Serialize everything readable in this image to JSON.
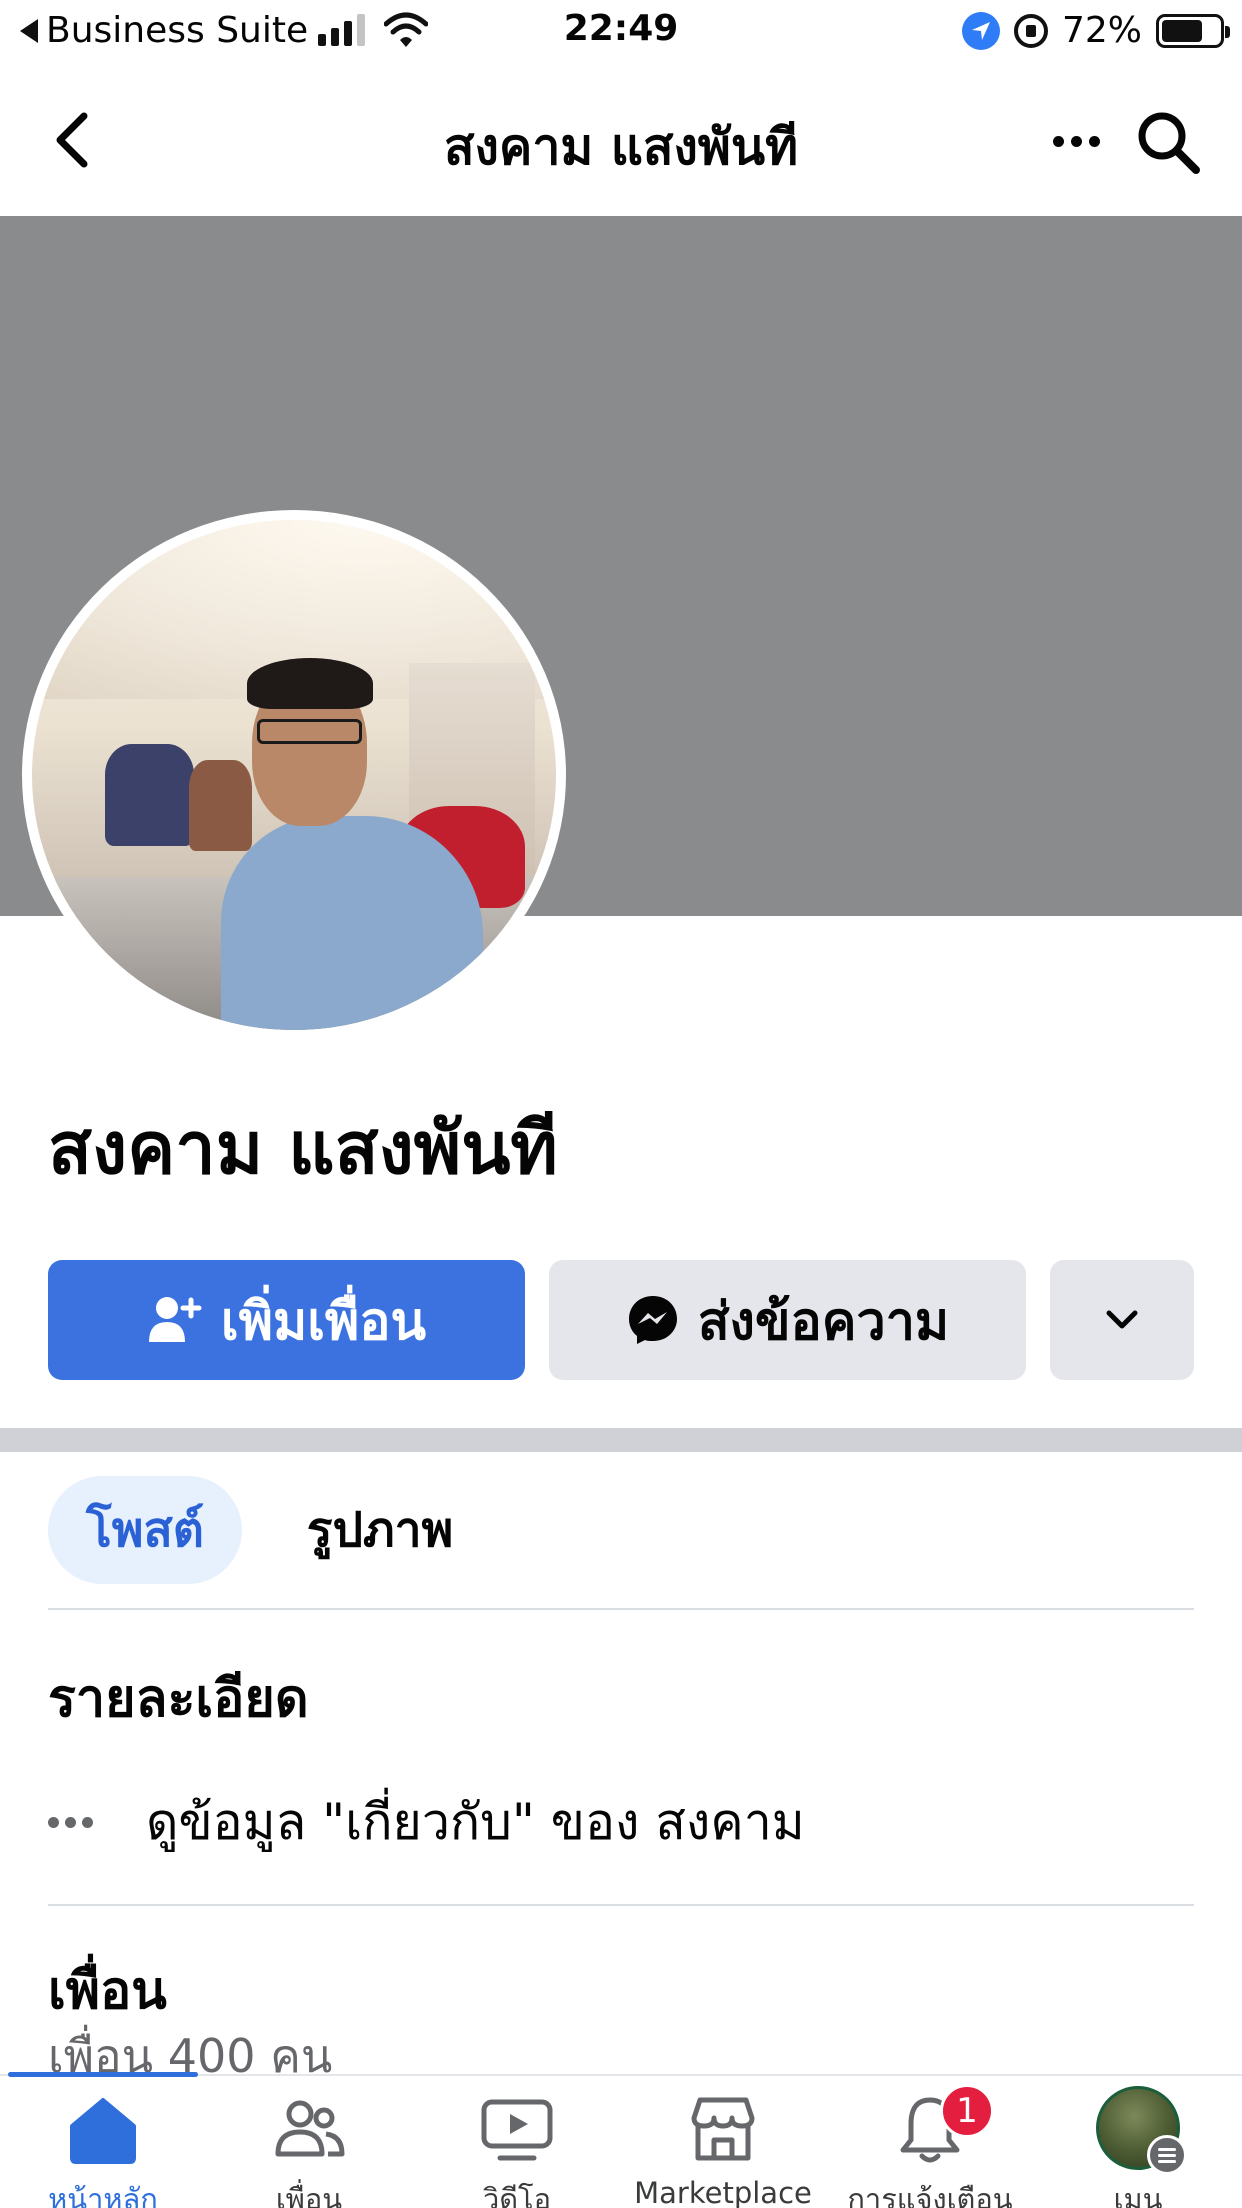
{
  "status_bar": {
    "back_app": "Business Suite",
    "time": "22:49",
    "battery": "72%",
    "battery_level": 0.72
  },
  "nav": {
    "title": "สงคาม แสงพันที"
  },
  "profile": {
    "name": "สงคาม แสงพันที"
  },
  "actions": {
    "add_friend": "เพิ่มเพื่อน",
    "message": "ส่งข้อความ"
  },
  "tabs": [
    {
      "label": "โพสต์",
      "active": true
    },
    {
      "label": "รูปภาพ",
      "active": false
    }
  ],
  "details": {
    "title": "รายละเอียด",
    "about_link": "ดูข้อมูล \"เกี่ยวกับ\" ของ สงคาม"
  },
  "friends": {
    "title": "เพื่อน",
    "count": "เพื่อน 400 คน"
  },
  "tabbar": {
    "home": "หน้าหลัก",
    "friends": "เพื่อน",
    "video": "วิดีโอ",
    "marketplace": "Marketplace",
    "notifications": "การแจ้งเตือน",
    "notification_badge": "1",
    "menu": "เมนู"
  },
  "colors": {
    "accent": "#3b72e0",
    "cover": "#898b8d",
    "badge": "#e41e3f",
    "secondary_button": "#e4e6eb"
  },
  "icons": [
    "back-chevron-icon",
    "more-icon",
    "search-icon",
    "add-user-icon",
    "messenger-icon",
    "chevron-down-icon",
    "home-icon",
    "friends-icon",
    "video-icon",
    "marketplace-icon",
    "bell-icon",
    "menu-icon"
  ]
}
